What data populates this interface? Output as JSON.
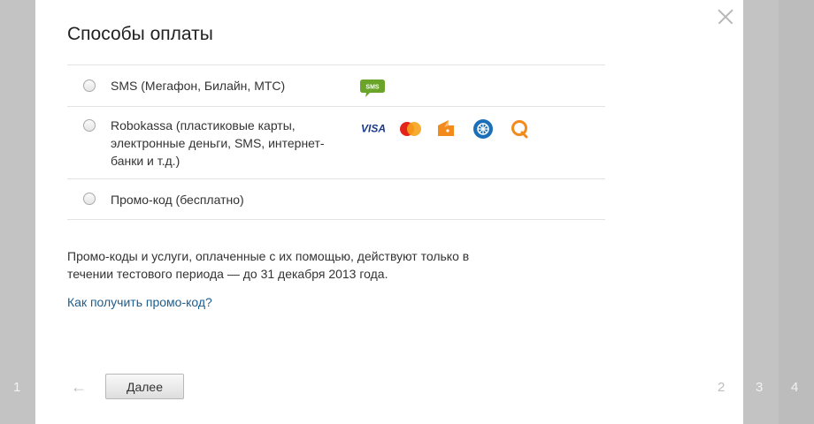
{
  "background_steps": {
    "left": "1",
    "right_a": "3",
    "right_b": "4"
  },
  "modal": {
    "title": "Способы оплаты",
    "options": [
      {
        "label": "SMS (Мегафон, Билайн, МТС)",
        "icons": [
          "sms-icon"
        ]
      },
      {
        "label": "Robokassa (пластиковые карты, электронные деньги, SMS, интернет-банки и т.д.)",
        "icons": [
          "visa-icon",
          "mastercard-icon",
          "yandex-money-icon",
          "webmoney-icon",
          "qiwi-icon"
        ]
      },
      {
        "label": "Промо-код (бесплатно)",
        "icons": []
      }
    ],
    "sms_badge": "SMS",
    "visa_text": "VISA",
    "note": "Промо-коды и услуги, оплаченные с их помощью, действуют только в течении тестового периода — до 31 декабря 2013 года.",
    "help_link": "Как получить промо-код?",
    "back_arrow": "←",
    "next_button": "Далее",
    "step_number": "2"
  },
  "colors": {
    "link": "#1e5d8c",
    "sms_green": "#6aa52a",
    "visa_blue": "#1a3a8a",
    "orange": "#f28a1c"
  }
}
